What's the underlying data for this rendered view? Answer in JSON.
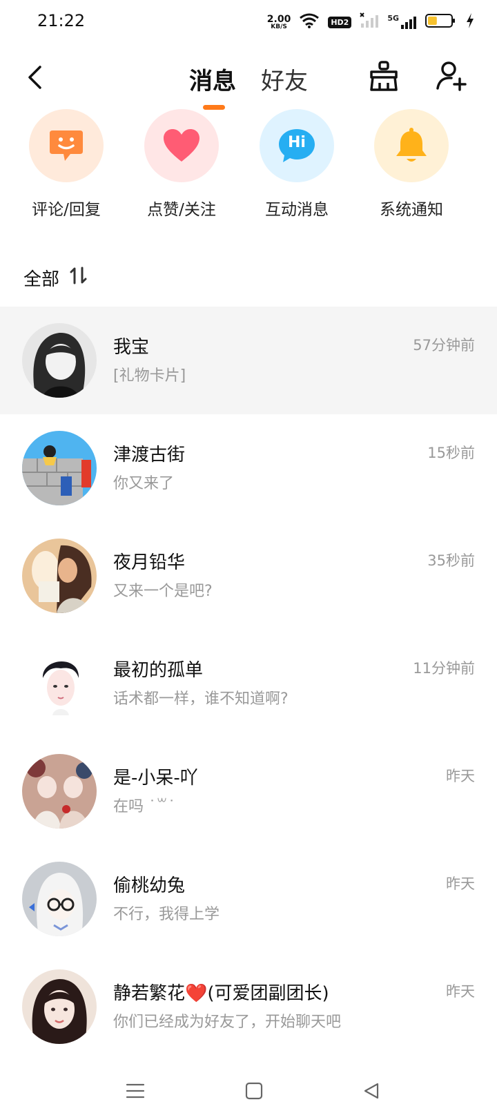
{
  "status_bar": {
    "time": "21:22",
    "net_speed_value": "2.00",
    "net_speed_unit": "KB/S",
    "hd_badge": "HD2",
    "signal_label": "5G",
    "battery_level": 0.4
  },
  "header": {
    "tabs": [
      {
        "label": "消息",
        "active": true
      },
      {
        "label": "好友",
        "active": false
      }
    ],
    "accent_color": "#ff7a1a"
  },
  "quick_entries": [
    {
      "label": "评论/回复",
      "icon": "smile-chat-icon",
      "bg": "#ffeadb",
      "color": "#ff8a3d"
    },
    {
      "label": "点赞/关注",
      "icon": "heart-icon",
      "bg": "#ffe6e6",
      "color": "#ff5c74"
    },
    {
      "label": "互动消息",
      "icon": "hi-bubble-icon",
      "bg": "#dff3ff",
      "color": "#26aef2",
      "icon_text": "Hi"
    },
    {
      "label": "系统通知",
      "icon": "bell-icon",
      "bg": "#fff1d6",
      "color": "#ffb21a"
    }
  ],
  "filter": {
    "label": "全部",
    "sort_icon": "sort-icon"
  },
  "conversations": [
    {
      "name": "我宝",
      "preview": "[礼物卡片]",
      "time": "57分钟前",
      "highlight": true,
      "avatar_colors": [
        "#e8e8e8",
        "#222222"
      ]
    },
    {
      "name": "津渡古街",
      "preview": "你又来了",
      "time": "15秒前",
      "highlight": false,
      "avatar_colors": [
        "#4fb4f0",
        "#aaaaaa"
      ]
    },
    {
      "name": "夜月铅华",
      "preview": "又来一个是吧?",
      "time": "35秒前",
      "highlight": false,
      "avatar_colors": [
        "#f5d6a8",
        "#5a3a2a"
      ]
    },
    {
      "name": "最初的孤单",
      "preview": "话术都一样，谁不知道啊?",
      "time": "11分钟前",
      "highlight": false,
      "avatar_colors": [
        "#ffffff",
        "#1a1a22"
      ]
    },
    {
      "name": "是-小呆-吖",
      "preview": "在吗 ˙꒳˙",
      "time": "昨天",
      "highlight": false,
      "avatar_colors": [
        "#d9b3a3",
        "#8a3a3a"
      ]
    },
    {
      "name": "偷桃幼兔",
      "preview": "不行，我得上学",
      "time": "昨天",
      "highlight": false,
      "avatar_colors": [
        "#cfd3d8",
        "#f2f2f2"
      ]
    },
    {
      "name": "静若繁花❤️(可爱团副团长)",
      "preview": "你们已经成为好友了，开始聊天吧",
      "time": "昨天",
      "highlight": false,
      "avatar_colors": [
        "#f3e0d6",
        "#2a1a18"
      ]
    }
  ],
  "system_nav": {
    "items": [
      "menu-icon",
      "home-icon",
      "back-triangle-icon"
    ]
  }
}
